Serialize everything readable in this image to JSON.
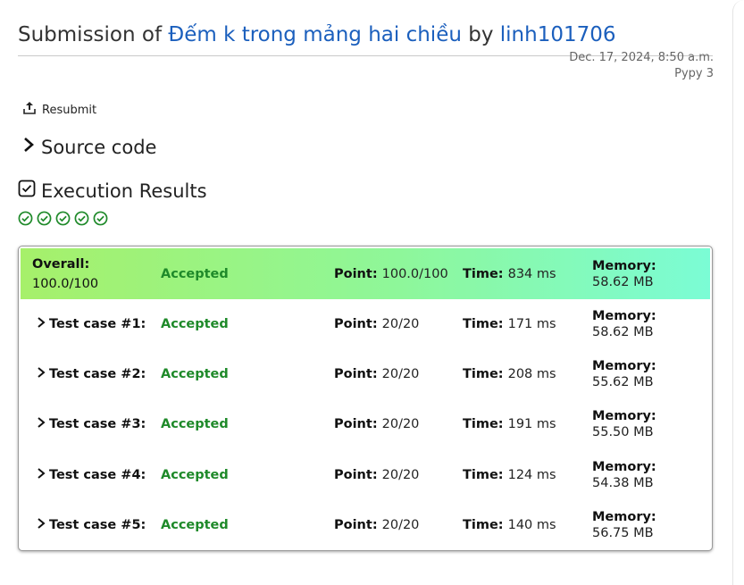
{
  "header": {
    "prefix": "Submission of",
    "problem_link": "Đếm k trong mảng hai chiều",
    "by": "by",
    "user_link": "linh101706",
    "date": "Dec. 17, 2024, 8:50 a.m.",
    "language": "Pypy 3"
  },
  "actions": {
    "resubmit_label": "Resubmit",
    "resubmit_icon": "upload-icon"
  },
  "sections": {
    "source_code": "Source code",
    "execution_results": "Execution Results"
  },
  "status_checks": {
    "count": 5,
    "icon": "check-circle-icon",
    "color": "#1f8a2a"
  },
  "overall": {
    "name": "Overall:",
    "name_value": "100.0/100",
    "status": "Accepted",
    "point_label": "Point:",
    "point": "100.0/100",
    "time_label": "Time:",
    "time": "834 ms",
    "memory_label": "Memory:",
    "memory": "58.62 MB"
  },
  "test_cases": [
    {
      "name": "Test case #1:",
      "status": "Accepted",
      "point_label": "Point:",
      "point": "20/20",
      "time_label": "Time:",
      "time": "171 ms",
      "memory_label": "Memory:",
      "memory": "58.62 MB"
    },
    {
      "name": "Test case #2:",
      "status": "Accepted",
      "point_label": "Point:",
      "point": "20/20",
      "time_label": "Time:",
      "time": "208 ms",
      "memory_label": "Memory:",
      "memory": "55.62 MB"
    },
    {
      "name": "Test case #3:",
      "status": "Accepted",
      "point_label": "Point:",
      "point": "20/20",
      "time_label": "Time:",
      "time": "191 ms",
      "memory_label": "Memory:",
      "memory": "55.50 MB"
    },
    {
      "name": "Test case #4:",
      "status": "Accepted",
      "point_label": "Point:",
      "point": "20/20",
      "time_label": "Time:",
      "time": "124 ms",
      "memory_label": "Memory:",
      "memory": "54.38 MB"
    },
    {
      "name": "Test case #5:",
      "status": "Accepted",
      "point_label": "Point:",
      "point": "20/20",
      "time_label": "Time:",
      "time": "140 ms",
      "memory_label": "Memory:",
      "memory": "56.75 MB"
    }
  ],
  "colors": {
    "link": "#1b5fbd",
    "accepted": "#1f8a2a",
    "overall_gradient_start": "#a6f06a",
    "overall_gradient_end": "#7bfcd5"
  }
}
